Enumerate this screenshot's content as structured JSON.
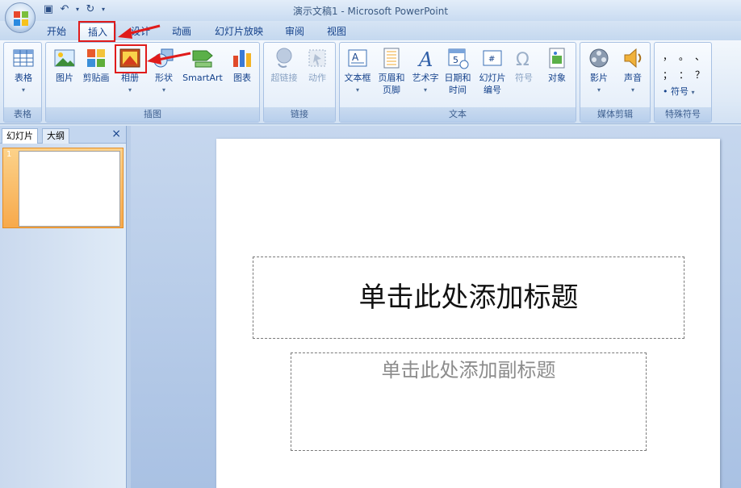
{
  "window": {
    "title": "演示文稿1 - Microsoft PowerPoint"
  },
  "tabs": [
    {
      "label": "开始"
    },
    {
      "label": "插入"
    },
    {
      "label": "设计"
    },
    {
      "label": "动画"
    },
    {
      "label": "幻灯片放映"
    },
    {
      "label": "审阅"
    },
    {
      "label": "视图"
    }
  ],
  "ribbon": {
    "groups": [
      {
        "label": "表格",
        "buttons": [
          {
            "label": "表格"
          }
        ]
      },
      {
        "label": "插图",
        "buttons": [
          {
            "label": "图片"
          },
          {
            "label": "剪贴画"
          },
          {
            "label": "相册"
          },
          {
            "label": "形状"
          },
          {
            "label": "SmartArt"
          },
          {
            "label": "图表"
          }
        ]
      },
      {
        "label": "链接",
        "buttons": [
          {
            "label": "超链接"
          },
          {
            "label": "动作"
          }
        ]
      },
      {
        "label": "文本",
        "buttons": [
          {
            "label": "文本框"
          },
          {
            "label": "页眉和",
            "label2": "页脚"
          },
          {
            "label": "艺术字"
          },
          {
            "label": "日期和",
            "label2": "时间"
          },
          {
            "label": "幻灯片",
            "label2": "编号"
          },
          {
            "label": "符号"
          },
          {
            "label": "对象"
          }
        ]
      },
      {
        "label": "媒体剪辑",
        "buttons": [
          {
            "label": "影片"
          },
          {
            "label": "声音"
          }
        ]
      },
      {
        "label": "特殊符号",
        "buttons": [
          {
            "label": "符号"
          }
        ],
        "symbols": [
          "，",
          "。",
          "、",
          "；",
          "：",
          "？"
        ]
      }
    ]
  },
  "left_panel": {
    "tabs": [
      {
        "label": "幻灯片"
      },
      {
        "label": "大纲"
      }
    ],
    "close": "×",
    "slide_number": "1"
  },
  "slide": {
    "title_placeholder": "单击此处添加标题",
    "subtitle_placeholder": "单击此处添加副标题"
  },
  "annotations": {
    "highlight_color": "#e01b1b"
  }
}
